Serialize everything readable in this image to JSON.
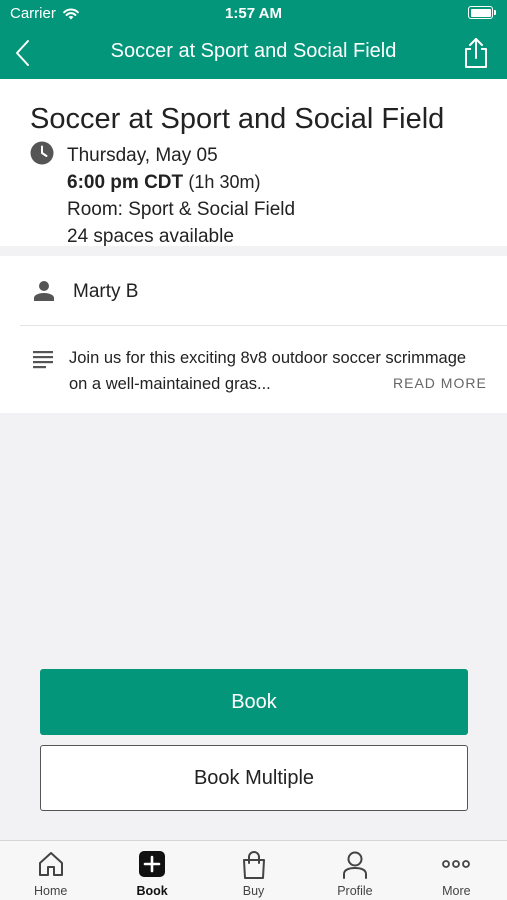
{
  "status_bar": {
    "carrier": "Carrier",
    "time": "1:57 AM"
  },
  "nav": {
    "title": "Soccer at Sport and Social Field"
  },
  "event": {
    "title": "Soccer at Sport and Social Field",
    "date": "Thursday, May 05",
    "time": "6:00 pm CDT",
    "duration": "(1h 30m)",
    "room": "Room: Sport & Social Field",
    "spaces": "24 spaces available"
  },
  "instructor": {
    "name": "Marty B"
  },
  "description": {
    "text": "Join us for this exciting 8v8 outdoor soccer scrimmage on a well-maintained gras...",
    "read_more": "READ MORE"
  },
  "actions": {
    "book": "Book",
    "book_multiple": "Book Multiple"
  },
  "tabbar": {
    "items": [
      {
        "label": "Home",
        "icon": "home-icon"
      },
      {
        "label": "Book",
        "icon": "plus-square-icon"
      },
      {
        "label": "Buy",
        "icon": "shopping-bag-icon"
      },
      {
        "label": "Profile",
        "icon": "profile-icon"
      },
      {
        "label": "More",
        "icon": "more-dots-icon"
      }
    ],
    "active": "Book"
  },
  "colors": {
    "brand": "#04967a",
    "background": "#f2f2f4",
    "card": "#ffffff"
  }
}
